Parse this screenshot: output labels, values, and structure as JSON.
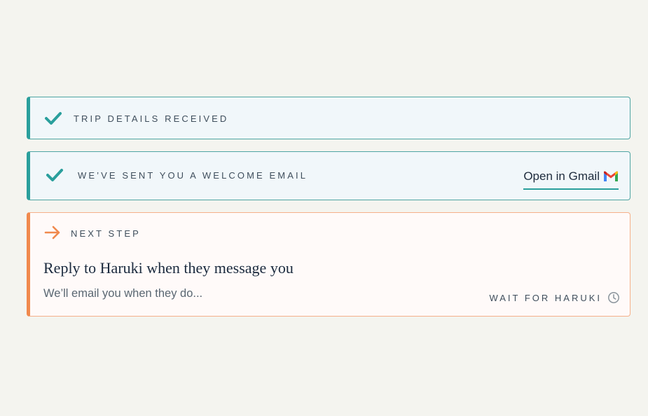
{
  "colors": {
    "page_background": "#f4f4ef",
    "done_accent": "#2a9f9c",
    "next_accent": "#f0894d",
    "heading_text": "#1b2a3e",
    "muted_text": "#5a6772"
  },
  "steps": [
    {
      "status": "done",
      "icon": "check-icon",
      "label": "TRIP DETAILS RECEIVED"
    },
    {
      "status": "done",
      "icon": "check-icon",
      "label": "WE’VE SENT YOU A WELCOME EMAIL",
      "action": {
        "label": "Open in Gmail",
        "icon": "gmail-icon"
      }
    }
  ],
  "next_step": {
    "icon": "arrow-right-icon",
    "label": "NEXT STEP",
    "title": "Reply to Haruki when they message you",
    "subtitle": "We’ll email you when they do...",
    "status_label": "WAIT FOR HARUKI",
    "status_icon": "clock-icon"
  }
}
